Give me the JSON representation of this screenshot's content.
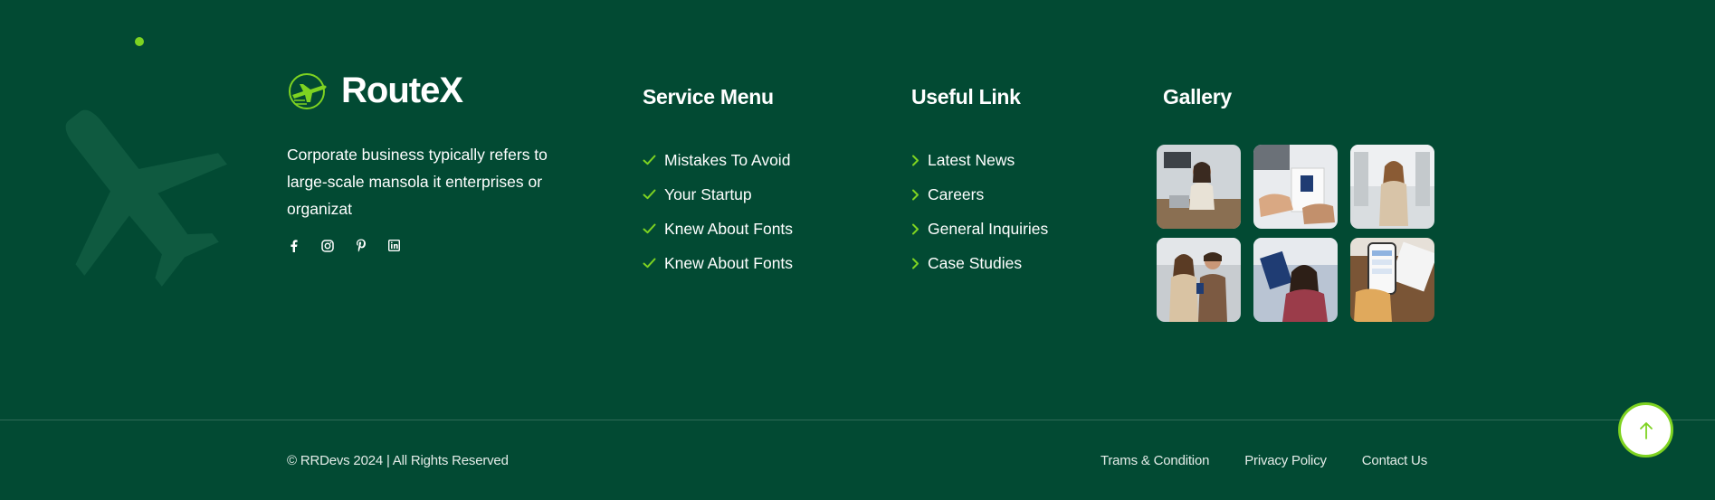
{
  "brand": {
    "name": "RouteX",
    "icon": "plane-logo-icon"
  },
  "about": {
    "text": "Corporate business typically refers to large-scale mansola it enterprises or organizat"
  },
  "socials": [
    "facebook-icon",
    "instagram-icon",
    "pinterest-icon",
    "linkedin-icon"
  ],
  "service_menu": {
    "title": "Service Menu",
    "items": [
      "Mistakes To Avoid",
      "Your Startup",
      "Knew About Fonts",
      "Knew About Fonts"
    ]
  },
  "useful_link": {
    "title": "Useful Link",
    "items": [
      "Latest News",
      "Careers",
      "General Inquiries",
      "Case Studies"
    ]
  },
  "gallery": {
    "title": "Gallery",
    "count": 6
  },
  "footer": {
    "copyright": "© RRDevs 2024 | All Rights Reserved",
    "links": [
      "Trams & Condition",
      "Privacy Policy",
      "Contact Us"
    ]
  },
  "colors": {
    "background": "#024a33",
    "accent": "#7ed321",
    "text": "#ffffff"
  }
}
